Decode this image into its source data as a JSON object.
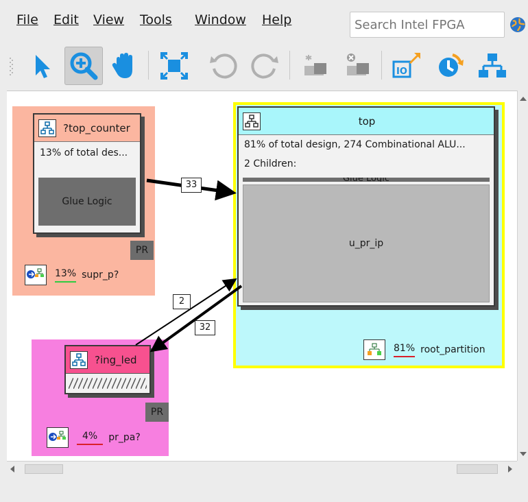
{
  "menu": {
    "file": "File",
    "edit": "Edit",
    "view": "View",
    "tools": "Tools",
    "window": "Window",
    "help": "Help"
  },
  "search": {
    "placeholder": "Search Intel FPGA"
  },
  "toolbar": {
    "icons": [
      "select-arrow-icon",
      "zoom-icon",
      "pan-hand-icon",
      "fit-to-window-icon",
      "rotate-left-icon",
      "rotate-right-icon",
      "add-partition-icon",
      "remove-partition-icon",
      "io-export-icon",
      "refresh-icon",
      "hierarchy-icon"
    ],
    "active": "zoom-icon"
  },
  "nodes": {
    "top_counter": {
      "title": "?top_counter",
      "detail": "13% of total des...",
      "block": "Glue Logic",
      "badge": "PR",
      "percent": "13%",
      "partition": "supr_p?",
      "percent_underline_color": "#2ecc40",
      "region_color": "#fbb6a0"
    },
    "top": {
      "title": "top",
      "detail": "81% of total design, 274 Combinational ALU...",
      "children": "2 Children:",
      "glue": "Glue Logic",
      "block": "u_pr_ip",
      "percent": "81%",
      "partition": "root_partition",
      "percent_underline_color": "#d9202a",
      "region_color": "#bdf8fb",
      "border_color": "#ffff00"
    },
    "ing_led": {
      "title": "?ing_led",
      "badge": "PR",
      "percent": "4%",
      "partition": "pr_pa?",
      "percent_underline_color": "#d9202a",
      "region_color": "#f77fe0",
      "header_color": "#f7518f"
    }
  },
  "connections": {
    "counter_to_top": "33",
    "led_to_top": "2",
    "top_to_led": "32"
  },
  "colors": {
    "accent_blue": "#1a8fe0",
    "orange": "#f5a020"
  }
}
